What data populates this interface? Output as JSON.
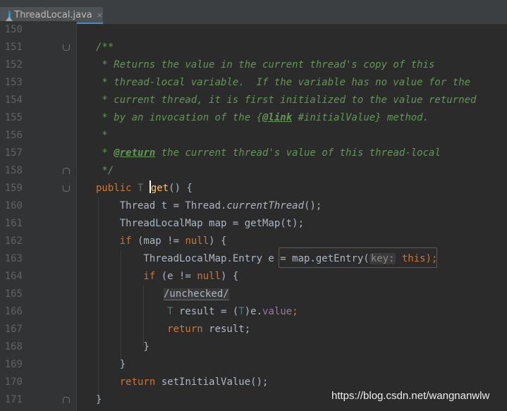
{
  "tab": {
    "label": "ThreadLocal.java",
    "close": "×"
  },
  "lines": [
    {
      "num": "150"
    },
    {
      "num": "151",
      "c1": "/**"
    },
    {
      "num": "152",
      "c1": " * Returns the value in the current thread's copy of this"
    },
    {
      "num": "153",
      "c1": " * thread-local variable.  If the variable has no value for the"
    },
    {
      "num": "154",
      "c1": " * current thread, it is first initialized to the value returned"
    },
    {
      "num": "155",
      "c1": " * by an invocation of the {",
      "link": "@link",
      "c2": " #initialValue} method."
    },
    {
      "num": "156",
      "c1": " *"
    },
    {
      "num": "157",
      "c1": " * ",
      "ret": "@return",
      "c2": " the current thread's value of this thread-local"
    },
    {
      "num": "158",
      "c1": " */"
    },
    {
      "num": "159",
      "kw": "public",
      "type": " T ",
      "fn": "get",
      "rest": "() {"
    },
    {
      "num": "160",
      "a": "    Thread t = Thread.",
      "st": "currentThread",
      "b": "();"
    },
    {
      "num": "161",
      "a": "    ThreadLocalMap map = getMap(t);"
    },
    {
      "num": "162",
      "kw1": "    if",
      "a": " (map != ",
      "kw2": "null",
      "b": ") {"
    },
    {
      "num": "163",
      "a": "        ThreadLocalMap.Entry e = ",
      "b": "map.getEntry(",
      "hint": "key:",
      "kw": " this",
      "c": ");"
    },
    {
      "num": "164",
      "kw1": "        if",
      "a": " (e != ",
      "kw2": "null",
      "b": ") {"
    },
    {
      "num": "165",
      "sup": "/unchecked/"
    },
    {
      "num": "166",
      "type": "            T",
      "a": " result = (",
      "type2": "T",
      "b": ")e.",
      "fld": "value",
      "c": ";"
    },
    {
      "num": "167",
      "kw": "            return",
      "a": " result;"
    },
    {
      "num": "168",
      "a": "        }"
    },
    {
      "num": "169",
      "a": "    }"
    },
    {
      "num": "170",
      "kw": "    return",
      "a": " setInitialValue();"
    },
    {
      "num": "171",
      "a": "}"
    }
  ],
  "watermark": "https://blog.csdn.net/wangnanwlw"
}
